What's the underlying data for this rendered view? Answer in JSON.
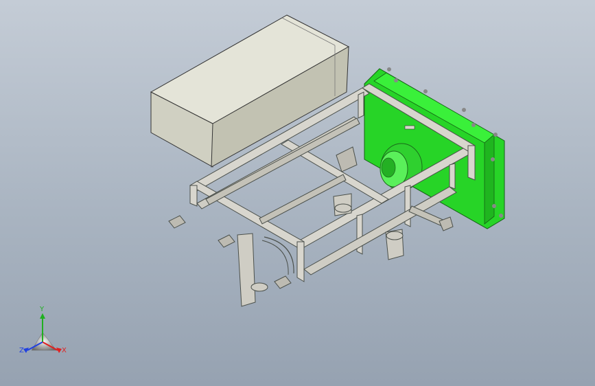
{
  "viewport": {
    "background": "#a9b4c1",
    "colors": {
      "frame": "#d6d4cc",
      "frame_edge": "#555a55",
      "box": "#d2d2c4",
      "box_top": "#e2e2d6",
      "box_side": "#bcbcae",
      "panel": "#2ee52e",
      "panel_edge": "#1a8a1a"
    }
  },
  "triad": {
    "x_label": "X",
    "y_label": "Y",
    "z_label": "Z",
    "x_color": "#e02020",
    "y_color": "#20b020",
    "z_color": "#2040e0"
  }
}
